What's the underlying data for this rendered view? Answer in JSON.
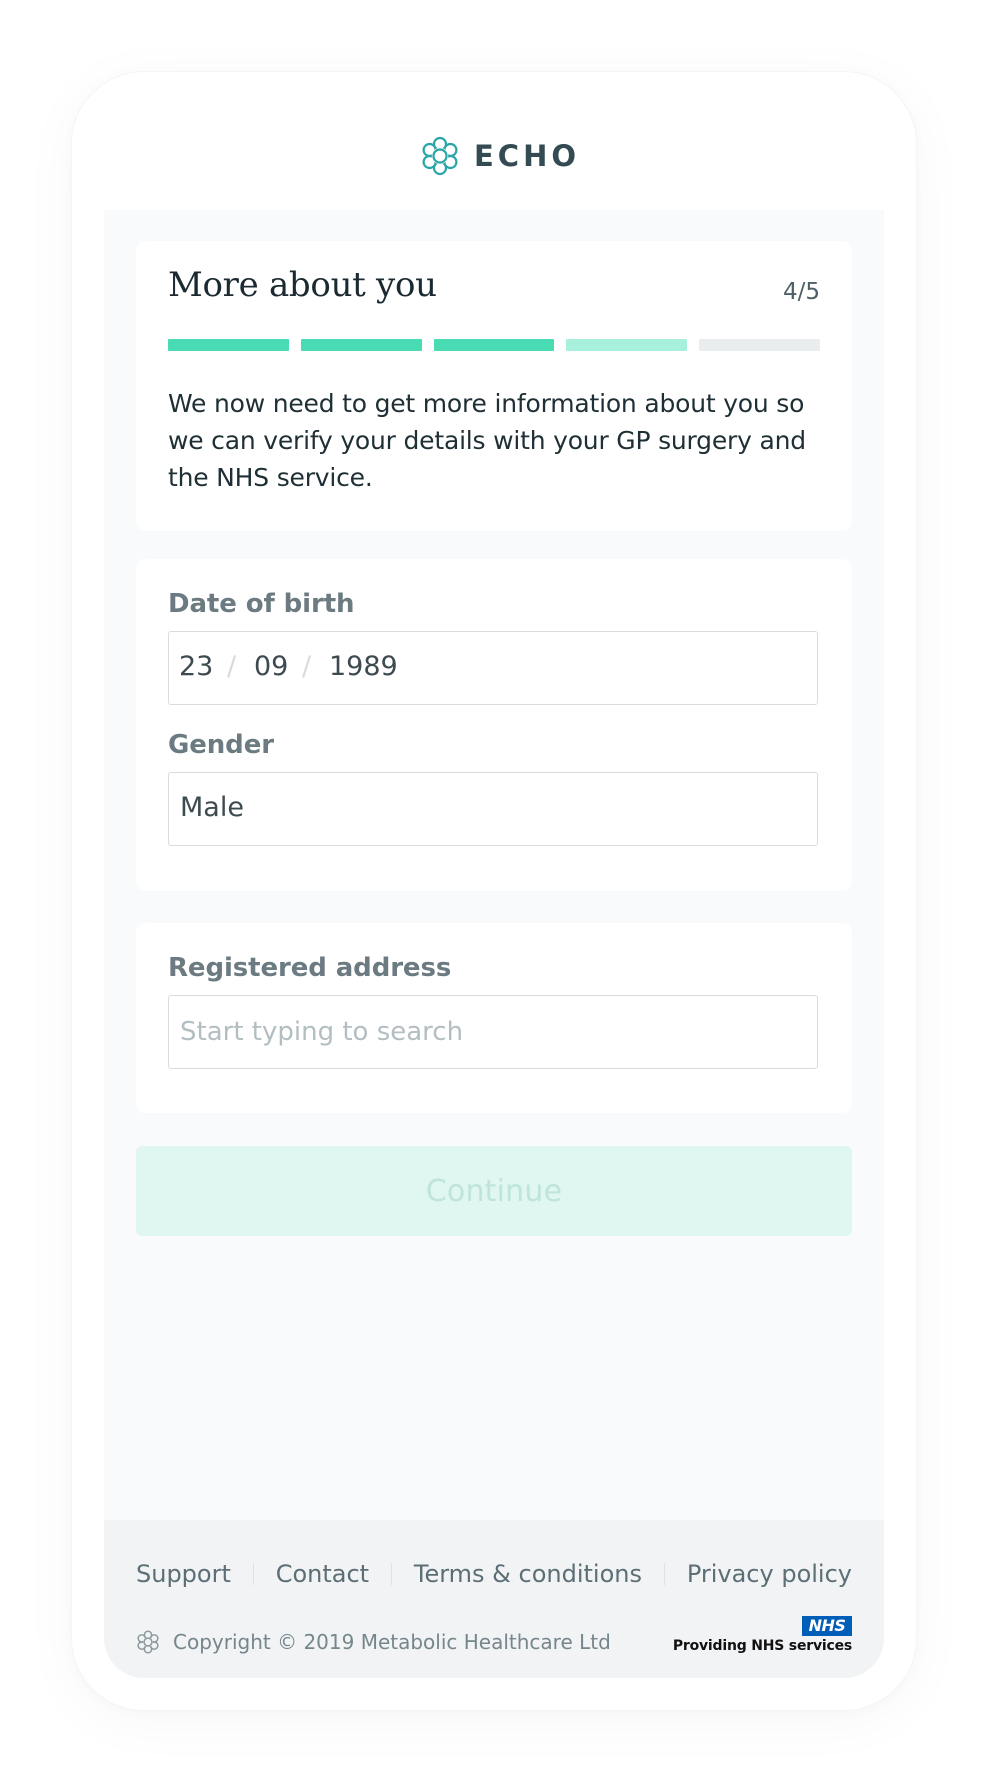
{
  "app": {
    "brand_name": "ECHO",
    "logo_icon": "echo-logo-icon"
  },
  "intro": {
    "title": "More about you",
    "step": "4/5",
    "progress_fraction": 0.8,
    "text": "We now need to get more information about you so we can verify your details with your GP surgery and the NHS service."
  },
  "progress_segments": [
    {
      "state": "complete",
      "color": "#49dbb4"
    },
    {
      "state": "complete",
      "color": "#49dbb4"
    },
    {
      "state": "complete",
      "color": "#49dbb4"
    },
    {
      "state": "current",
      "color": "#a6f0dc"
    },
    {
      "state": "pending",
      "color": "#eaedee"
    }
  ],
  "dob": {
    "label": "Date of birth",
    "day": "23",
    "month": "09",
    "year": "1989",
    "separator": "/"
  },
  "gender": {
    "label": "Gender",
    "value": "Male"
  },
  "address": {
    "label": "Registered address",
    "value": "",
    "placeholder": "Start typing to search"
  },
  "continue": {
    "label": "Continue",
    "disabled": true,
    "background": "#e0f6f1",
    "text_color": "#bfe4dc"
  },
  "footer": {
    "links": [
      "Support",
      "Contact",
      "Terms & conditions",
      "Privacy policy"
    ],
    "copyright": "Copyright © 2019 Metabolic Healthcare Ltd",
    "nhs_logo_text": "NHS",
    "nhs_caption": "Providing NHS services"
  },
  "colors": {
    "brand_teal": "#2aa5a8",
    "accent_green": "#49dbb4",
    "nhs_blue": "#005eb8",
    "text_dark": "#1b2a30",
    "label_grey": "#6b7b81"
  }
}
